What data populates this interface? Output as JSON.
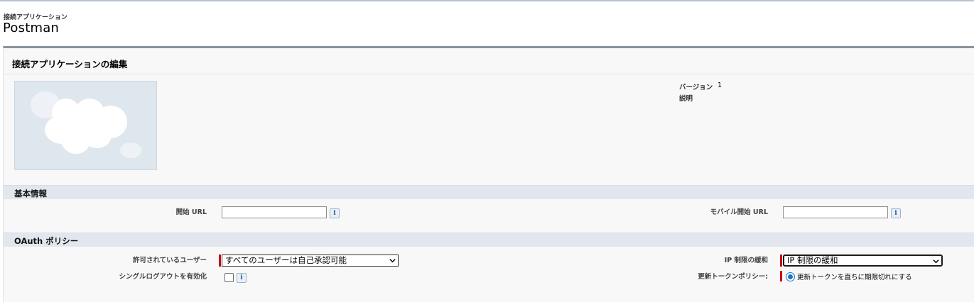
{
  "header": {
    "breadcrumb": "接続アプリケーション",
    "title": "Postman"
  },
  "panel": {
    "title": "接続アプリケーションの編集",
    "version_label": "バージョン",
    "version_value": "1",
    "description_label": "説明"
  },
  "basic_info": {
    "section_title": "基本情報",
    "start_url_label": "開始 URL",
    "start_url_value": "",
    "mobile_start_url_label": "モバイル開始 URL",
    "mobile_start_url_value": ""
  },
  "oauth": {
    "section_title": "OAuth ポリシー",
    "permitted_users_label": "許可されているユーザー",
    "permitted_users_value": "すべてのユーザーは自己承認可能",
    "ip_relax_label": "IP 制限の緩和",
    "ip_relax_value": "IP 制限の緩和",
    "single_logout_label": "シングルログアウトを有効化",
    "single_logout_checked": false,
    "refresh_token_label": "更新トークンポリシー:",
    "refresh_token_option": "更新トークンを直ちに期限切れにする",
    "refresh_token_selected": true
  },
  "icons": {
    "info": "i"
  }
}
